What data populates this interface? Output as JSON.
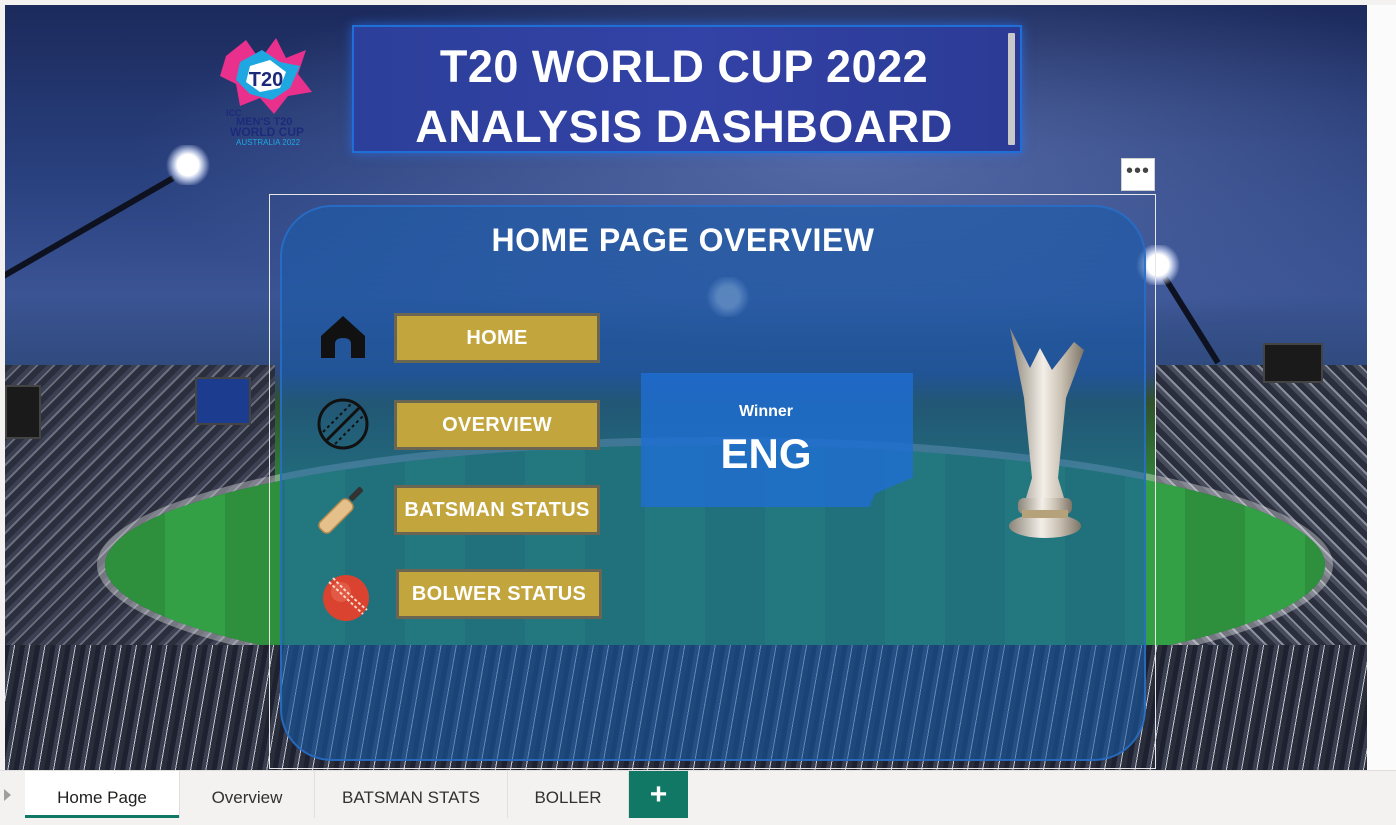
{
  "header": {
    "title_line1": "T20 WORLD CUP 2022",
    "title_line2": "ANALYSIS DASHBOARD"
  },
  "logo": {
    "icon": "icc-t20-world-cup-logo",
    "text_icc": "ICC",
    "text_mens": "MEN'S T20",
    "text_world_cup": "WORLD CUP",
    "text_location": "AUSTRALIA 2022"
  },
  "overview_panel": {
    "title": "HOME PAGE OVERVIEW",
    "more_options_label": "•••",
    "nav_buttons": [
      {
        "label": "HOME",
        "icon": "home-icon"
      },
      {
        "label": "OVERVIEW",
        "icon": "cricket-ball-outline-icon"
      },
      {
        "label": "BATSMAN STATUS",
        "icon": "cricket-bat-icon"
      },
      {
        "label": "BOLWER STATUS",
        "icon": "cricket-ball-icon"
      }
    ],
    "winner": {
      "label": "Winner",
      "value": "ENG"
    }
  },
  "sheet_tabs": {
    "tabs": [
      {
        "label": "Home Page",
        "active": true
      },
      {
        "label": "Overview",
        "active": false
      },
      {
        "label": "BATSMAN STATS",
        "active": false
      },
      {
        "label": "BOLLER",
        "active": false
      }
    ],
    "add_label": "+"
  },
  "colors": {
    "button_gold": "#c2a53d",
    "panel_blue": "#185caa",
    "tab_accent": "#117865"
  }
}
